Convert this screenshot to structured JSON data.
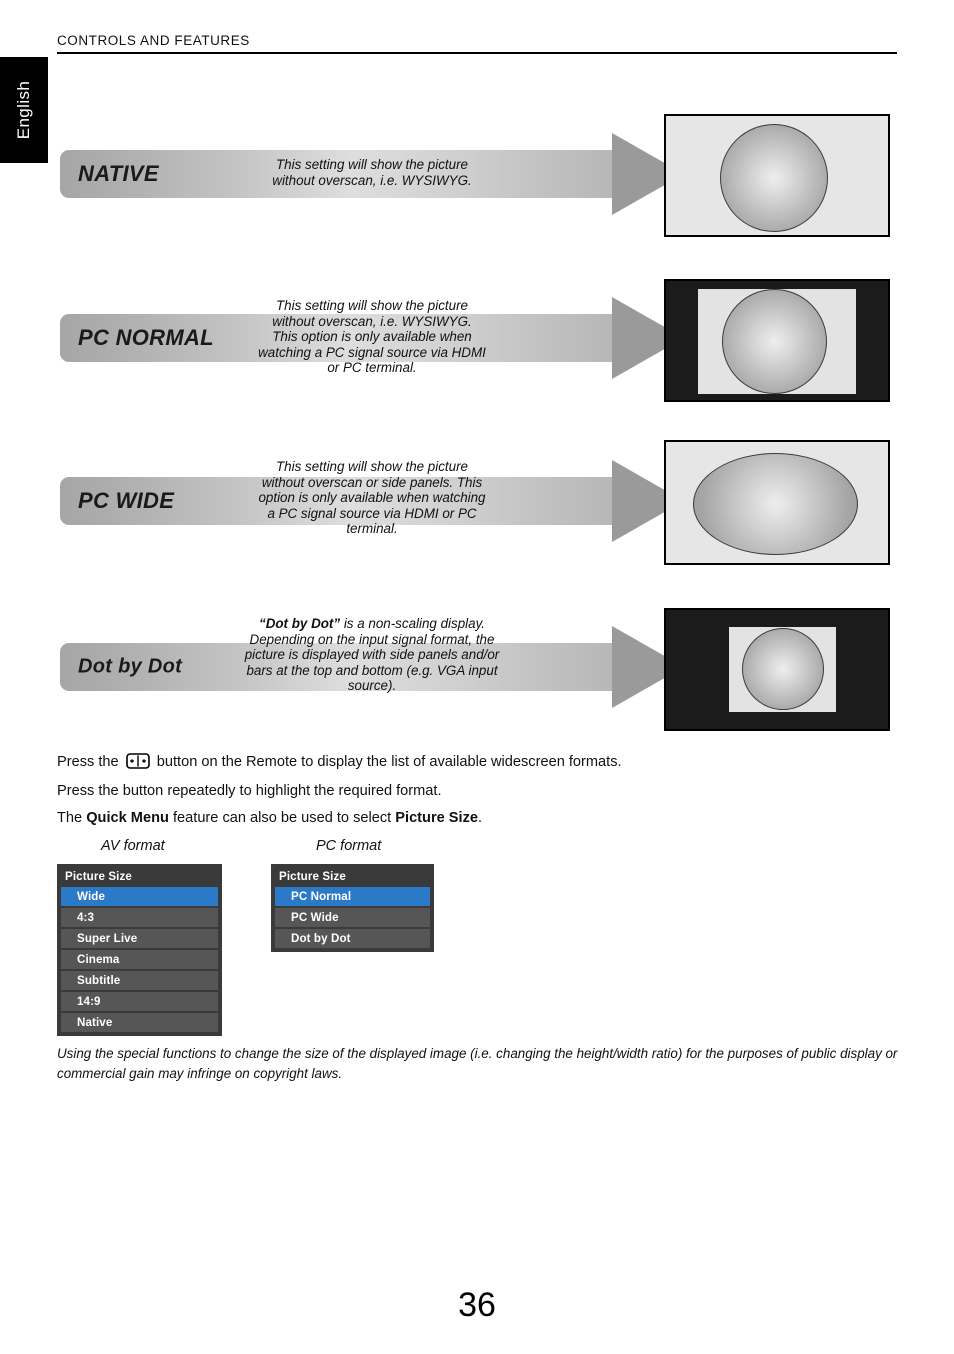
{
  "header": {
    "title": "CONTROLS AND FEATURES",
    "language_tab": "English"
  },
  "formats": [
    {
      "name": "NATIVE",
      "description": "This setting will show the picture without overscan, i.e. WYSIWYG.",
      "icon_name": "tv-preview-native"
    },
    {
      "name": "PC NORMAL",
      "description": "This setting will show the picture without overscan, i.e. WYSIWYG. This option is only available when watching a PC signal source via HDMI or PC terminal.",
      "icon_name": "tv-preview-pc-normal"
    },
    {
      "name": "PC WIDE",
      "description": "This setting will show the picture without overscan or side panels. This option is only available when watching a PC signal source via HDMI or PC terminal.",
      "icon_name": "tv-preview-pc-wide"
    },
    {
      "name": "Dot by Dot",
      "description_lead": "“Dot by Dot”",
      "description": " is a non-scaling display. Depending on the input signal format, the picture is displayed with side panels and/or bars at the top and bottom (e.g. VGA input source).",
      "icon_name": "tv-preview-dot-by-dot"
    }
  ],
  "instructions": {
    "line1_before_icon": "Press the ",
    "icon_name": "widescreen-format-button-icon",
    "line1_after_icon": " button on the Remote to display the list of available widescreen formats.",
    "line2": "Press the button repeatedly to highlight the required format.",
    "line3_part1": "The ",
    "line3_bold1": "Quick Menu",
    "line3_part2": " feature can also be used to select ",
    "line3_bold2": "Picture Size",
    "line3_part3": "."
  },
  "menus": {
    "av": {
      "caption": "AV format",
      "title": "Picture Size",
      "items": [
        {
          "label": "Wide",
          "selected": true
        },
        {
          "label": "4:3",
          "selected": false
        },
        {
          "label": "Super Live",
          "selected": false
        },
        {
          "label": "Cinema",
          "selected": false
        },
        {
          "label": "Subtitle",
          "selected": false
        },
        {
          "label": "14:9",
          "selected": false
        },
        {
          "label": "Native",
          "selected": false
        }
      ]
    },
    "pc": {
      "caption": "PC format",
      "title": "Picture Size",
      "items": [
        {
          "label": "PC Normal",
          "selected": true
        },
        {
          "label": "PC Wide",
          "selected": false
        },
        {
          "label": "Dot by Dot",
          "selected": false
        }
      ]
    }
  },
  "footnote": "Using the special functions to change the size of the displayed image (i.e. changing the height/width ratio) for the purposes of public display or commercial gain may infringe on copyright laws.",
  "page_number": "36",
  "colors": {
    "menu_background": "#3a3a3a",
    "menu_item": "#565656",
    "menu_selected": "#2a7ac8",
    "banner_gray": "#9a9a9a",
    "panel_light": "#e6e6e6",
    "panel_black": "#1b1b1b"
  }
}
